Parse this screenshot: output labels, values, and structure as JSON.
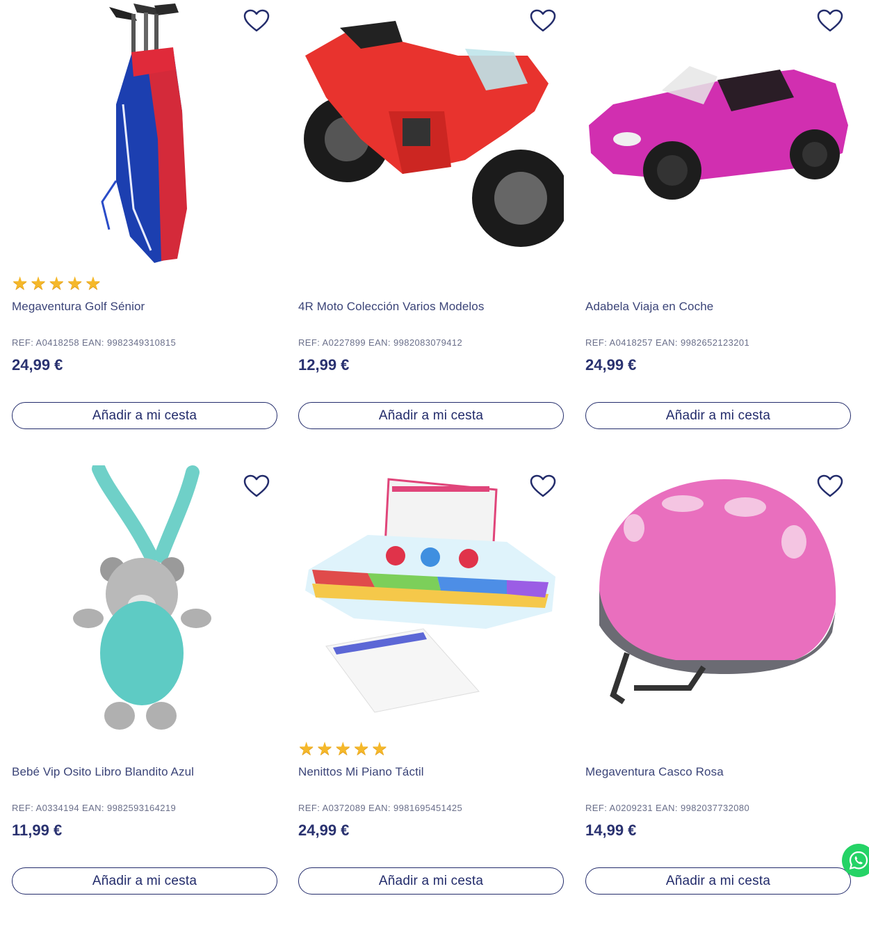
{
  "labels": {
    "add_to_cart": "Añadir a mi cesta",
    "star_glyph": "★"
  },
  "colors": {
    "accent": "#232c6b",
    "star": "#f5b82a",
    "whatsapp": "#25d366"
  },
  "products": [
    {
      "name": "Megaventura Golf Sénior",
      "ref": "REF: A0418258 EAN: 9982349310815",
      "price": "24,99 €",
      "rating": 5,
      "image": "golf-bag-image"
    },
    {
      "name": "4R Moto Colección Varios Modelos",
      "ref": "REF: A0227899 EAN: 9982083079412",
      "price": "12,99 €",
      "rating": null,
      "image": "motorcycle-image"
    },
    {
      "name": "Adabela Viaja en Coche",
      "ref": "REF: A0418257 EAN: 9982652123201",
      "price": "24,99 €",
      "rating": null,
      "image": "pink-car-image"
    },
    {
      "name": "Bebé Vip Osito Libro Blandito Azul",
      "ref": "REF: A0334194 EAN: 9982593164219",
      "price": "11,99 €",
      "rating": null,
      "image": "teddy-bear-image"
    },
    {
      "name": "Nenittos Mi Piano Táctil",
      "ref": "REF: A0372089 EAN: 9981695451425",
      "price": "24,99 €",
      "rating": 5,
      "image": "toy-piano-image"
    },
    {
      "name": "Megaventura Casco Rosa",
      "ref": "REF: A0209231 EAN: 9982037732080",
      "price": "14,99 €",
      "rating": null,
      "image": "pink-helmet-image"
    }
  ],
  "icons": {
    "favorite": "heart-outline-icon",
    "chat": "whatsapp-icon"
  }
}
